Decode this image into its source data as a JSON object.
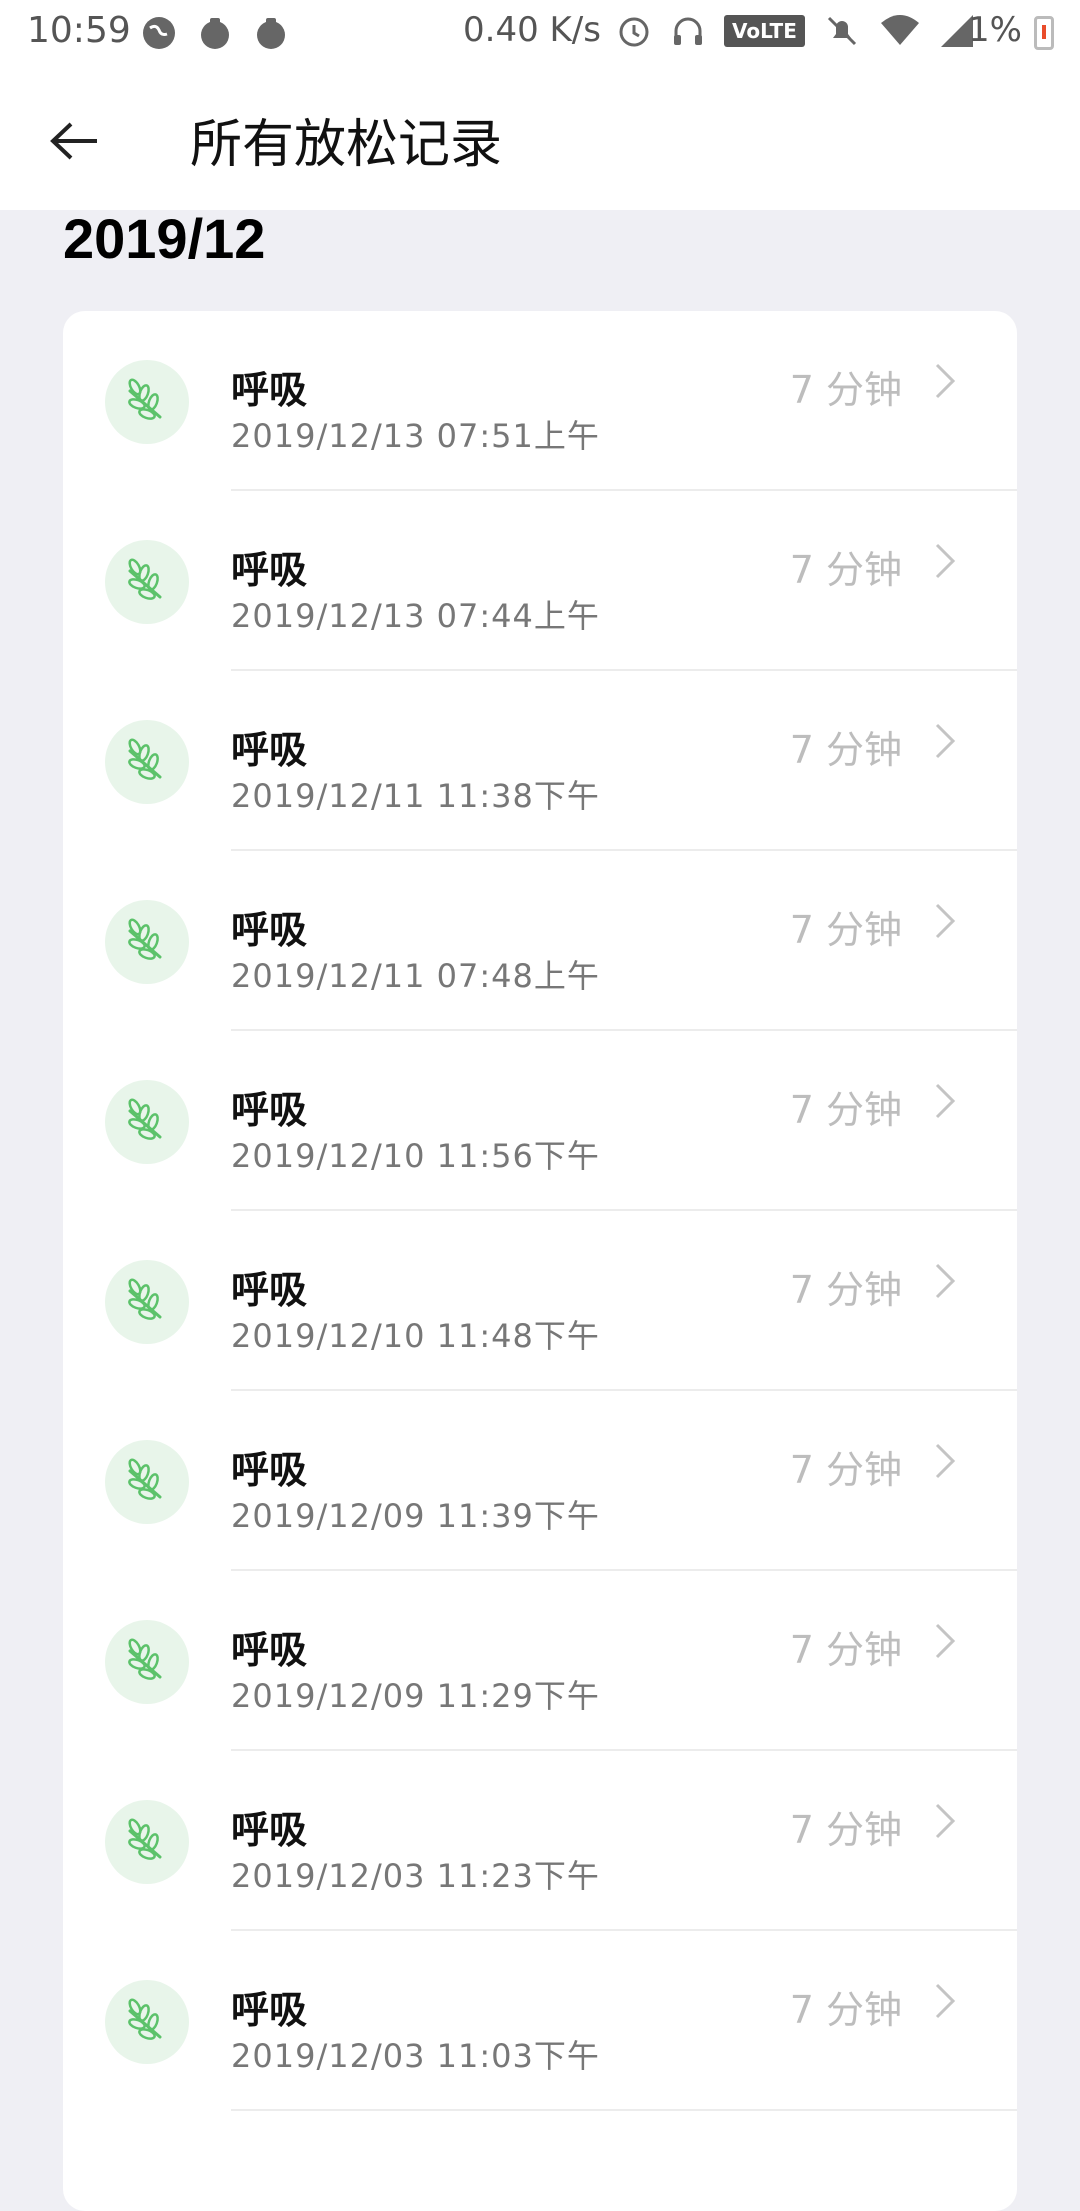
{
  "status_bar": {
    "time": "10:59",
    "net_speed": "0.40 K/s",
    "volte": "VoLTE",
    "battery": "1%"
  },
  "app_bar": {
    "title": "所有放松记录",
    "back_icon": "arrow-left-icon"
  },
  "section": {
    "heading": "2019/12"
  },
  "records": [
    {
      "title": "呼吸",
      "date": "2019/12/13 07:51上午",
      "duration": "7 分钟"
    },
    {
      "title": "呼吸",
      "date": "2019/12/13 07:44上午",
      "duration": "7 分钟"
    },
    {
      "title": "呼吸",
      "date": "2019/12/11 11:38下午",
      "duration": "7 分钟"
    },
    {
      "title": "呼吸",
      "date": "2019/12/11 07:48上午",
      "duration": "7 分钟"
    },
    {
      "title": "呼吸",
      "date": "2019/12/10 11:56下午",
      "duration": "7 分钟"
    },
    {
      "title": "呼吸",
      "date": "2019/12/10 11:48下午",
      "duration": "7 分钟"
    },
    {
      "title": "呼吸",
      "date": "2019/12/09 11:39下午",
      "duration": "7 分钟"
    },
    {
      "title": "呼吸",
      "date": "2019/12/09 11:29下午",
      "duration": "7 分钟"
    },
    {
      "title": "呼吸",
      "date": "2019/12/03 11:23下午",
      "duration": "7 分钟"
    },
    {
      "title": "呼吸",
      "date": "2019/12/03 11:03下午",
      "duration": "7 分钟"
    }
  ],
  "colors": {
    "accent_green": "#5cc26a",
    "icon_bg": "#e8f5ea",
    "page_bg": "#efeff4"
  },
  "icons": {
    "record_icon": "leaf-icon",
    "row_chevron": "chevron-right-icon"
  }
}
